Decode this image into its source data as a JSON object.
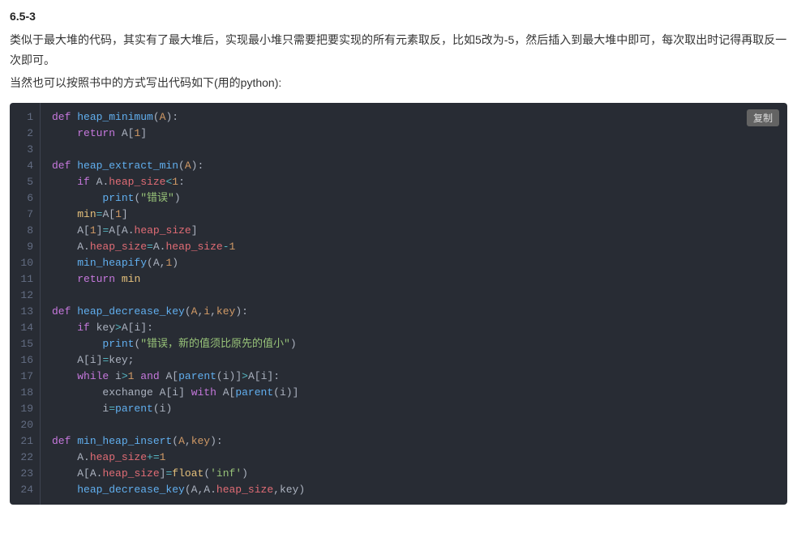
{
  "heading": "6.5-3",
  "para1": "类似于最大堆的代码，其实有了最大堆后，实现最小堆只需要把要实现的所有元素取反，比如5改为-5，然后插入到最大堆中即可，每次取出时记得再取反一次即可。",
  "para2": "当然也可以按照书中的方式写出代码如下(用的python):",
  "copy_label": "复制",
  "code": {
    "language": "python",
    "lines": [
      {
        "n": 1,
        "tokens": [
          [
            "kw",
            "def"
          ],
          [
            "plain",
            " "
          ],
          [
            "fn",
            "heap_minimum"
          ],
          [
            "paren",
            "("
          ],
          [
            "param",
            "A"
          ],
          [
            "paren",
            ")"
          ],
          [
            "punct",
            ":"
          ]
        ]
      },
      {
        "n": 2,
        "tokens": [
          [
            "plain",
            "    "
          ],
          [
            "kw",
            "return"
          ],
          [
            "plain",
            " "
          ],
          [
            "plain",
            "A"
          ],
          [
            "paren",
            "["
          ],
          [
            "num",
            "1"
          ],
          [
            "paren",
            "]"
          ]
        ]
      },
      {
        "n": 3,
        "tokens": []
      },
      {
        "n": 4,
        "tokens": [
          [
            "kw",
            "def"
          ],
          [
            "plain",
            " "
          ],
          [
            "fn",
            "heap_extract_min"
          ],
          [
            "paren",
            "("
          ],
          [
            "param",
            "A"
          ],
          [
            "paren",
            ")"
          ],
          [
            "punct",
            ":"
          ]
        ]
      },
      {
        "n": 5,
        "tokens": [
          [
            "plain",
            "    "
          ],
          [
            "kw",
            "if"
          ],
          [
            "plain",
            " A"
          ],
          [
            "punct",
            "."
          ],
          [
            "attr",
            "heap_size"
          ],
          [
            "op",
            "<"
          ],
          [
            "num",
            "1"
          ],
          [
            "punct",
            ":"
          ]
        ]
      },
      {
        "n": 6,
        "tokens": [
          [
            "plain",
            "        "
          ],
          [
            "fn",
            "print"
          ],
          [
            "paren",
            "("
          ],
          [
            "str",
            "\"错误\""
          ],
          [
            "paren",
            ")"
          ]
        ]
      },
      {
        "n": 7,
        "tokens": [
          [
            "plain",
            "    "
          ],
          [
            "builtin",
            "min"
          ],
          [
            "op",
            "="
          ],
          [
            "plain",
            "A"
          ],
          [
            "paren",
            "["
          ],
          [
            "num",
            "1"
          ],
          [
            "paren",
            "]"
          ]
        ]
      },
      {
        "n": 8,
        "tokens": [
          [
            "plain",
            "    A"
          ],
          [
            "paren",
            "["
          ],
          [
            "num",
            "1"
          ],
          [
            "paren",
            "]"
          ],
          [
            "op",
            "="
          ],
          [
            "plain",
            "A"
          ],
          [
            "paren",
            "["
          ],
          [
            "plain",
            "A"
          ],
          [
            "punct",
            "."
          ],
          [
            "attr",
            "heap_size"
          ],
          [
            "paren",
            "]"
          ]
        ]
      },
      {
        "n": 9,
        "tokens": [
          [
            "plain",
            "    A"
          ],
          [
            "punct",
            "."
          ],
          [
            "attr",
            "heap_size"
          ],
          [
            "op",
            "="
          ],
          [
            "plain",
            "A"
          ],
          [
            "punct",
            "."
          ],
          [
            "attr",
            "heap_size"
          ],
          [
            "op",
            "-"
          ],
          [
            "num",
            "1"
          ]
        ]
      },
      {
        "n": 10,
        "tokens": [
          [
            "plain",
            "    "
          ],
          [
            "fn",
            "min_heapify"
          ],
          [
            "paren",
            "("
          ],
          [
            "plain",
            "A"
          ],
          [
            "punct",
            ","
          ],
          [
            "num",
            "1"
          ],
          [
            "paren",
            ")"
          ]
        ]
      },
      {
        "n": 11,
        "tokens": [
          [
            "plain",
            "    "
          ],
          [
            "kw",
            "return"
          ],
          [
            "plain",
            " "
          ],
          [
            "builtin",
            "min"
          ]
        ]
      },
      {
        "n": 12,
        "tokens": []
      },
      {
        "n": 13,
        "tokens": [
          [
            "kw",
            "def"
          ],
          [
            "plain",
            " "
          ],
          [
            "fn",
            "heap_decrease_key"
          ],
          [
            "paren",
            "("
          ],
          [
            "param",
            "A"
          ],
          [
            "punct",
            ","
          ],
          [
            "param",
            "i"
          ],
          [
            "punct",
            ","
          ],
          [
            "param",
            "key"
          ],
          [
            "paren",
            ")"
          ],
          [
            "punct",
            ":"
          ]
        ]
      },
      {
        "n": 14,
        "tokens": [
          [
            "plain",
            "    "
          ],
          [
            "kw",
            "if"
          ],
          [
            "plain",
            " key"
          ],
          [
            "op",
            ">"
          ],
          [
            "plain",
            "A"
          ],
          [
            "paren",
            "["
          ],
          [
            "plain",
            "i"
          ],
          [
            "paren",
            "]"
          ],
          [
            "punct",
            ":"
          ]
        ]
      },
      {
        "n": 15,
        "tokens": [
          [
            "plain",
            "        "
          ],
          [
            "fn",
            "print"
          ],
          [
            "paren",
            "("
          ],
          [
            "str",
            "\"错误，新的值须比原先的值小\""
          ],
          [
            "paren",
            ")"
          ]
        ]
      },
      {
        "n": 16,
        "tokens": [
          [
            "plain",
            "    A"
          ],
          [
            "paren",
            "["
          ],
          [
            "plain",
            "i"
          ],
          [
            "paren",
            "]"
          ],
          [
            "op",
            "="
          ],
          [
            "plain",
            "key"
          ],
          [
            "punct",
            ";"
          ]
        ]
      },
      {
        "n": 17,
        "tokens": [
          [
            "plain",
            "    "
          ],
          [
            "kw",
            "while"
          ],
          [
            "plain",
            " i"
          ],
          [
            "op",
            ">"
          ],
          [
            "num",
            "1"
          ],
          [
            "plain",
            " "
          ],
          [
            "kw",
            "and"
          ],
          [
            "plain",
            " A"
          ],
          [
            "paren",
            "["
          ],
          [
            "fn",
            "parent"
          ],
          [
            "paren",
            "("
          ],
          [
            "plain",
            "i"
          ],
          [
            "paren",
            ")"
          ],
          [
            "paren",
            "]"
          ],
          [
            "op",
            ">"
          ],
          [
            "plain",
            "A"
          ],
          [
            "paren",
            "["
          ],
          [
            "plain",
            "i"
          ],
          [
            "paren",
            "]"
          ],
          [
            "punct",
            ":"
          ]
        ]
      },
      {
        "n": 18,
        "tokens": [
          [
            "plain",
            "        exchange A"
          ],
          [
            "paren",
            "["
          ],
          [
            "plain",
            "i"
          ],
          [
            "paren",
            "]"
          ],
          [
            "plain",
            " "
          ],
          [
            "kw",
            "with"
          ],
          [
            "plain",
            " A"
          ],
          [
            "paren",
            "["
          ],
          [
            "fn",
            "parent"
          ],
          [
            "paren",
            "("
          ],
          [
            "plain",
            "i"
          ],
          [
            "paren",
            ")"
          ],
          [
            "paren",
            "]"
          ]
        ]
      },
      {
        "n": 19,
        "tokens": [
          [
            "plain",
            "        i"
          ],
          [
            "op",
            "="
          ],
          [
            "fn",
            "parent"
          ],
          [
            "paren",
            "("
          ],
          [
            "plain",
            "i"
          ],
          [
            "paren",
            ")"
          ]
        ]
      },
      {
        "n": 20,
        "tokens": []
      },
      {
        "n": 21,
        "tokens": [
          [
            "kw",
            "def"
          ],
          [
            "plain",
            " "
          ],
          [
            "fn",
            "min_heap_insert"
          ],
          [
            "paren",
            "("
          ],
          [
            "param",
            "A"
          ],
          [
            "punct",
            ","
          ],
          [
            "param",
            "key"
          ],
          [
            "paren",
            ")"
          ],
          [
            "punct",
            ":"
          ]
        ]
      },
      {
        "n": 22,
        "tokens": [
          [
            "plain",
            "    A"
          ],
          [
            "punct",
            "."
          ],
          [
            "attr",
            "heap_size"
          ],
          [
            "op",
            "+="
          ],
          [
            "num",
            "1"
          ]
        ]
      },
      {
        "n": 23,
        "tokens": [
          [
            "plain",
            "    A"
          ],
          [
            "paren",
            "["
          ],
          [
            "plain",
            "A"
          ],
          [
            "punct",
            "."
          ],
          [
            "attr",
            "heap_size"
          ],
          [
            "paren",
            "]"
          ],
          [
            "op",
            "="
          ],
          [
            "builtin",
            "float"
          ],
          [
            "paren",
            "("
          ],
          [
            "str",
            "'inf'"
          ],
          [
            "paren",
            ")"
          ]
        ]
      },
      {
        "n": 24,
        "tokens": [
          [
            "plain",
            "    "
          ],
          [
            "fn",
            "heap_decrease_key"
          ],
          [
            "paren",
            "("
          ],
          [
            "plain",
            "A"
          ],
          [
            "punct",
            ","
          ],
          [
            "plain",
            "A"
          ],
          [
            "punct",
            "."
          ],
          [
            "attr",
            "heap_size"
          ],
          [
            "punct",
            ","
          ],
          [
            "plain",
            "key"
          ],
          [
            "paren",
            ")"
          ]
        ]
      }
    ]
  }
}
